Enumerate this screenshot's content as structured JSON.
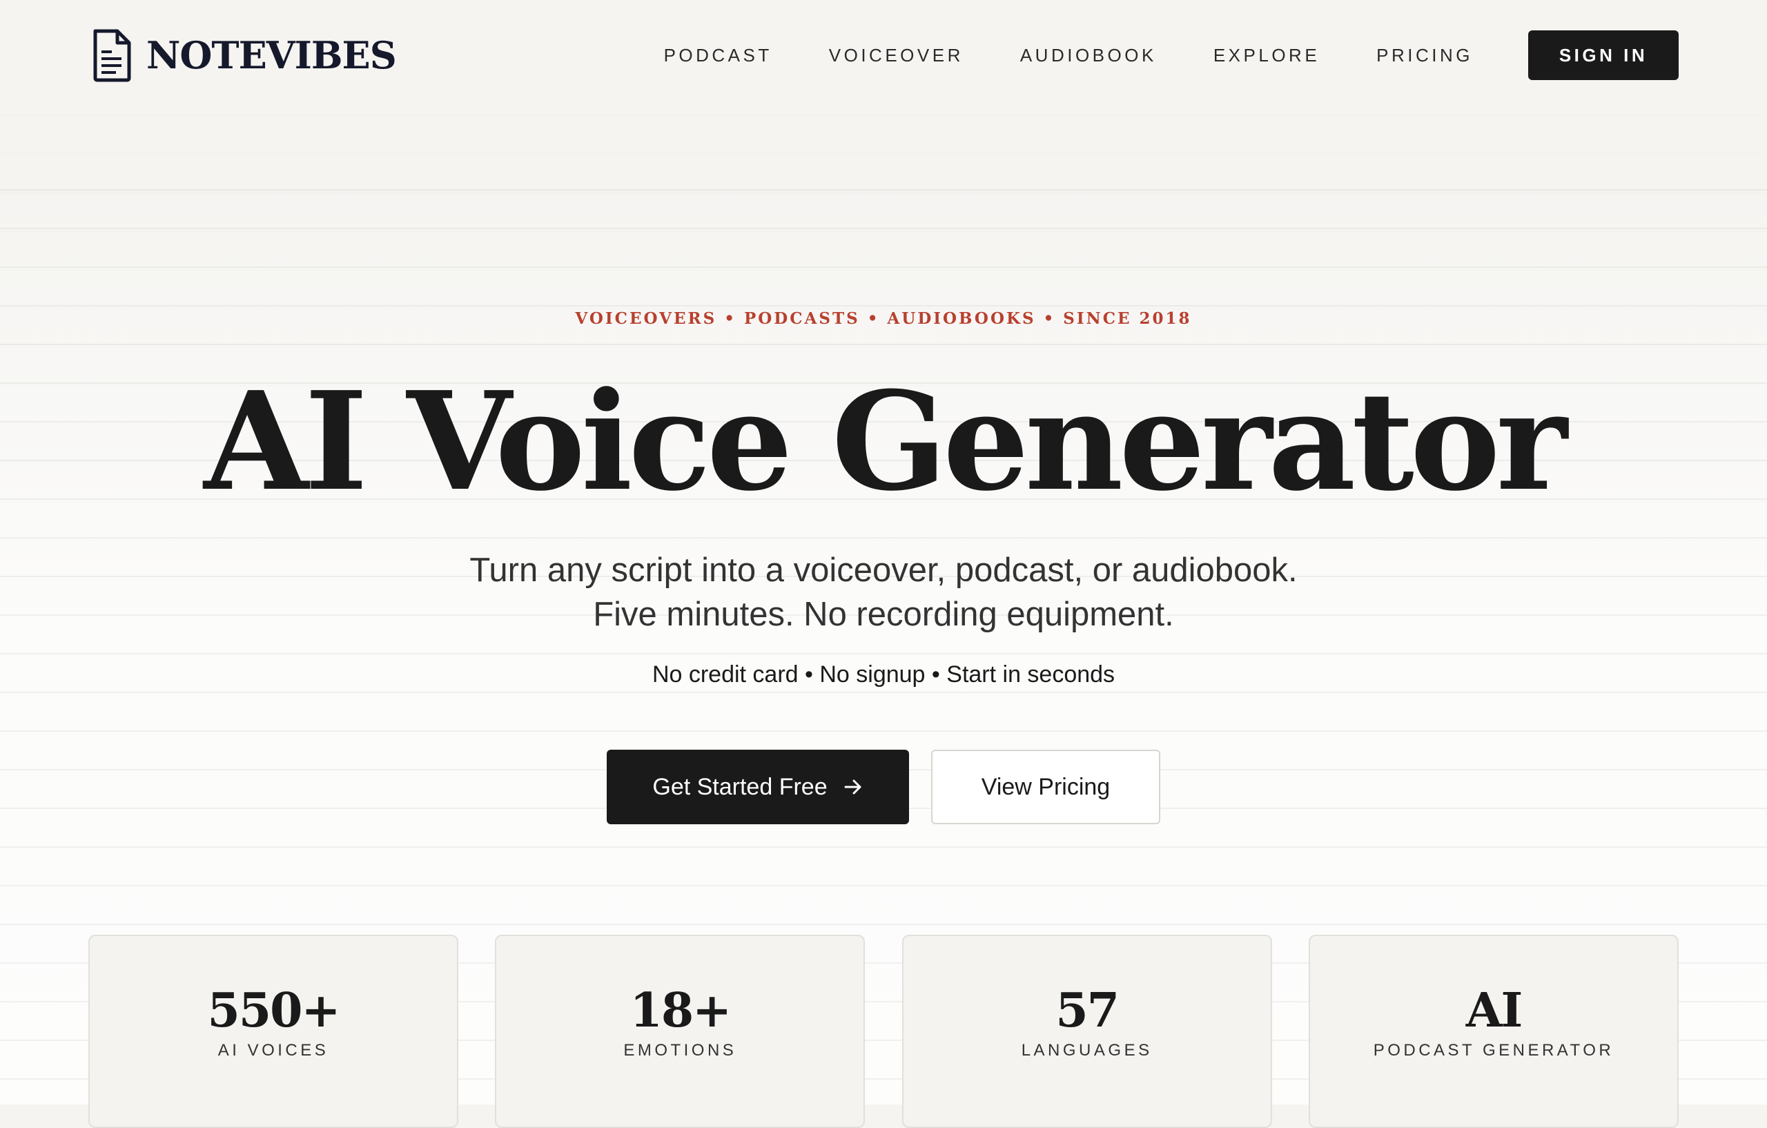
{
  "brand": {
    "name": "NOTEVIBES",
    "logo_icon": "document-icon"
  },
  "nav": {
    "items": [
      "PODCAST",
      "VOICEOVER",
      "AUDIOBOOK",
      "EXPLORE",
      "PRICING"
    ],
    "signin_label": "SIGN IN"
  },
  "hero": {
    "eyebrow": "VOICEOVERS • PODCASTS • AUDIOBOOKS • SINCE 2018",
    "title": "AI Voice Generator",
    "subtitle": "Turn any script into a voiceover, podcast, or audiobook. Five minutes. No recording equipment.",
    "tagline": "No credit card • No signup • Start in seconds",
    "primary_cta": "Get Started Free",
    "primary_cta_icon": "arrow-right-icon",
    "secondary_cta": "View Pricing"
  },
  "stats": [
    {
      "value": "550+",
      "label": "AI VOICES"
    },
    {
      "value": "18+",
      "label": "EMOTIONS"
    },
    {
      "value": "57",
      "label": "LANGUAGES"
    },
    {
      "value": "AI",
      "label": "PODCAST GENERATOR"
    }
  ],
  "colors": {
    "background": "#f5f4f1",
    "ink": "#1a1a1a",
    "accent": "#b8402f",
    "logo": "#15192b"
  }
}
